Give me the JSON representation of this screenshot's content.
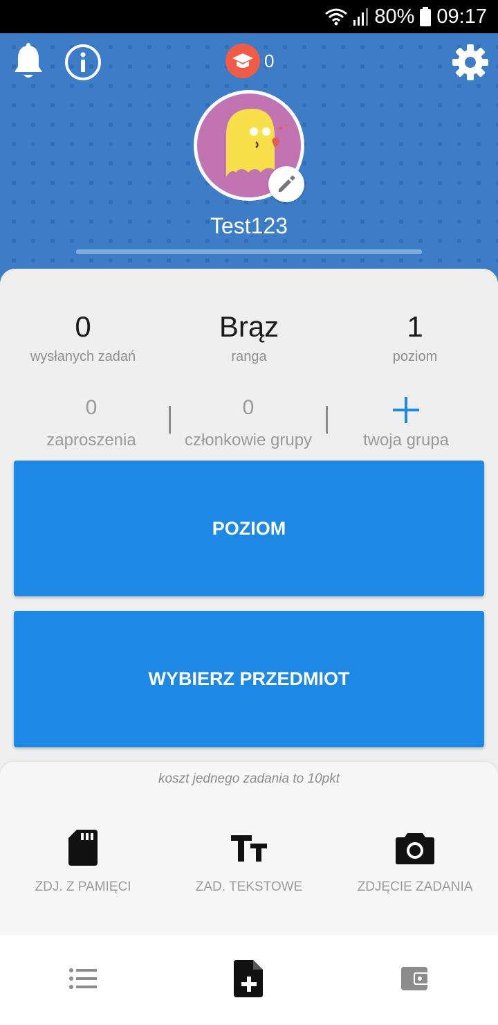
{
  "status_bar": {
    "battery": "80%",
    "time": "09:17"
  },
  "header": {
    "points": "0",
    "username": "Test123"
  },
  "stats": [
    {
      "value": "0",
      "label": "wysłanych zadań"
    },
    {
      "value": "Brąz",
      "label": "ranga"
    },
    {
      "value": "1",
      "label": "poziom"
    }
  ],
  "group": {
    "invitations": {
      "value": "0",
      "label": "zaproszenia"
    },
    "members": {
      "value": "0",
      "label": "członkowie grupy"
    },
    "your_group": {
      "label": "twoja grupa"
    }
  },
  "buttons": {
    "level": "POZIOM",
    "choose_subject": "WYBIERZ PRZEDMIOT"
  },
  "bottom": {
    "cost_note": "koszt jednego zadania to 10pkt",
    "actions": [
      {
        "label": "ZDJ. Z PAMIĘCI",
        "icon": "sd-card-icon"
      },
      {
        "label": "ZAD. TEKSTOWE",
        "icon": "text-size-icon"
      },
      {
        "label": "ZDJĘCIE ZADANIA",
        "icon": "camera-icon"
      }
    ]
  },
  "colors": {
    "header_blue": "#3d7dc8",
    "button_blue": "#1e88e5",
    "badge_red": "#ef5b45",
    "avatar_purple": "#c273b2"
  }
}
